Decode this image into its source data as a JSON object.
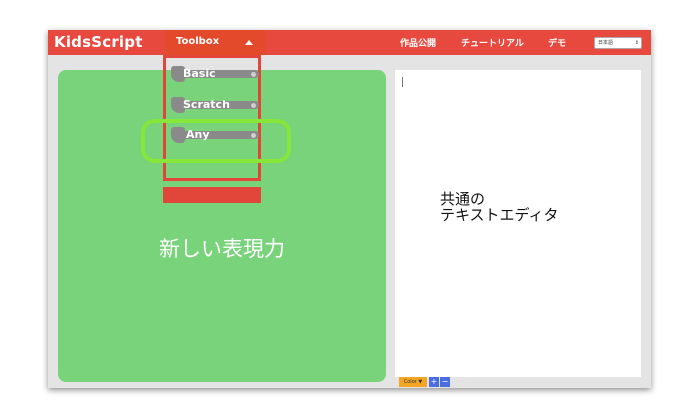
{
  "app": {
    "title": "KidsScript",
    "toolbox_label": "Toolbox",
    "nav": [
      "作品公開",
      "チュートリアル",
      "デモ"
    ],
    "language_select": "日本語"
  },
  "toolbox": {
    "items": [
      "Basic",
      "Scratch",
      "Any"
    ],
    "highlighted": "Any"
  },
  "left_pane": {
    "caption": "新しい表現力"
  },
  "editor": {
    "caption_line1": "共通の",
    "caption_line2": "テキストエディタ"
  },
  "editor_toolbar": {
    "color_label": "Color ▼",
    "plus_label": "+",
    "minus_label": "−"
  },
  "colors": {
    "header": "#e8493f",
    "left_pane": "#78d37a",
    "highlight": "#86e63a",
    "block": "#8a8a8a"
  }
}
